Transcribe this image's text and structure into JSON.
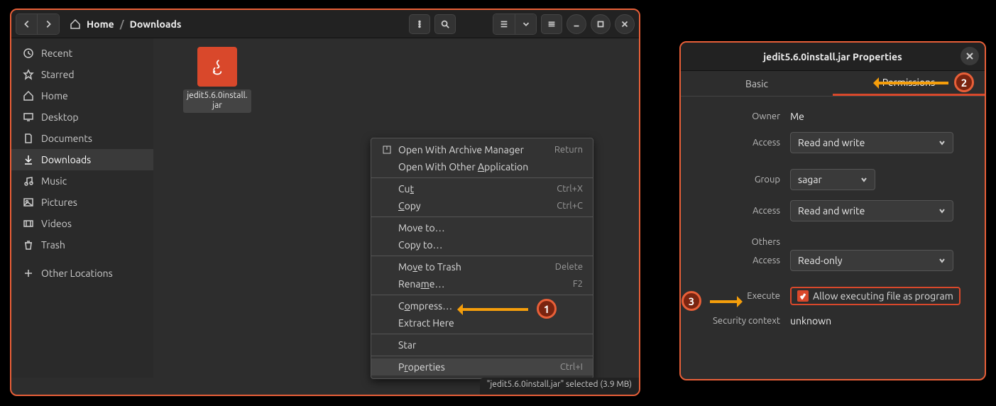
{
  "breadcrumb": {
    "home": "Home",
    "current": "Downloads"
  },
  "sidebar": {
    "items": [
      {
        "label": "Recent"
      },
      {
        "label": "Starred"
      },
      {
        "label": "Home"
      },
      {
        "label": "Desktop"
      },
      {
        "label": "Documents"
      },
      {
        "label": "Downloads"
      },
      {
        "label": "Music"
      },
      {
        "label": "Pictures"
      },
      {
        "label": "Videos"
      },
      {
        "label": "Trash"
      },
      {
        "label": "Other Locations"
      }
    ]
  },
  "file": {
    "name": "jedit5.6.0install.jar"
  },
  "statusbar": "\"jedit5.6.0install.jar\" selected  (3.9 MB)",
  "ctx": {
    "open_archive": "Open With Archive Manager",
    "open_archive_accel": "Return",
    "open_other": "Open With Other Application",
    "cut": "Cut",
    "cut_accel": "Ctrl+X",
    "copy": "Copy",
    "copy_accel": "Ctrl+C",
    "move_to": "Move to…",
    "copy_to": "Copy to…",
    "move_trash": "Move to Trash",
    "move_trash_accel": "Delete",
    "rename": "Rename…",
    "rename_accel": "F2",
    "compress": "Compress…",
    "extract": "Extract Here",
    "star": "Star",
    "properties": "Properties",
    "properties_accel": "Ctrl+I"
  },
  "props": {
    "title": "jedit5.6.0install.jar Properties",
    "tabs": {
      "basic": "Basic",
      "permissions": "Permissions"
    },
    "owner_label": "Owner",
    "owner_value": "Me",
    "access_label": "Access",
    "owner_access": "Read and write",
    "group_label": "Group",
    "group_value": "sagar",
    "group_access": "Read and write",
    "others_label": "Others",
    "others_access": "Read-only",
    "execute_label": "Execute",
    "execute_check": "Allow executing file as program",
    "sec_label": "Security context",
    "sec_value": "unknown"
  },
  "annotations": {
    "one": "1",
    "two": "2",
    "three": "3"
  }
}
